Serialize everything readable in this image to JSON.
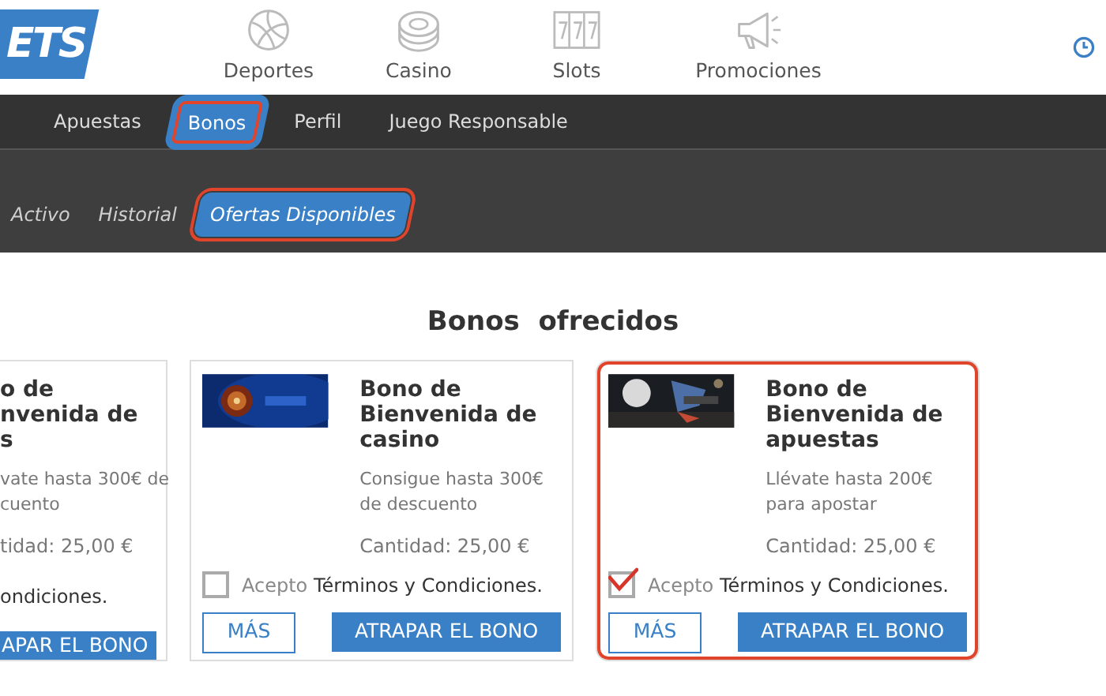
{
  "logo": {
    "text": "ETS"
  },
  "main_nav": [
    {
      "label": "Deportes"
    },
    {
      "label": "Casino"
    },
    {
      "label": "Slots"
    },
    {
      "label": "Promociones"
    }
  ],
  "tabs": [
    {
      "label": "Apuestas",
      "selected": false,
      "highlighted": false
    },
    {
      "label": "Bonos",
      "selected": true,
      "highlighted": true
    },
    {
      "label": "Perfil",
      "selected": false,
      "highlighted": false
    },
    {
      "label": "Juego Responsable",
      "selected": false,
      "highlighted": false
    }
  ],
  "subtabs": [
    {
      "label": "Activo",
      "selected": false,
      "highlighted": false
    },
    {
      "label": "Historial",
      "selected": false,
      "highlighted": false
    },
    {
      "label": "Ofertas Disponibles",
      "selected": true,
      "highlighted": true
    }
  ],
  "heading": "Bonos  ofrecidos",
  "cards": [
    {
      "kind": "cut",
      "title_lines": [
        "o de",
        "nvenida de",
        "s"
      ],
      "description_lines": [
        "vate hasta 300€ de",
        "cuento"
      ],
      "amount": "tidad: 25,00 €",
      "terms": "ondiciones.",
      "claim_button": "APAR EL BONO",
      "highlighted": false
    },
    {
      "kind": "full",
      "title": "Bono de Bienvenida de casino",
      "description": "Consigue hasta 300€ de descuento",
      "amount": "Cantidad: 25,00 €",
      "terms_prefix": "Acepto",
      "terms_link": "Términos y Condiciones.",
      "checked": false,
      "more_button": "MÁS",
      "claim_button": "ATRAPAR EL BONO",
      "highlighted": false
    },
    {
      "kind": "full",
      "title": "Bono de Bienvenida de apuestas",
      "description": "Llévate hasta 200€ para apostar",
      "amount": "Cantidad: 25,00 €",
      "terms_prefix": "Acepto",
      "terms_link": "Términos y Condiciones.",
      "checked": true,
      "more_button": "MÁS",
      "claim_button": "ATRAPAR EL BONO",
      "highlighted": true
    }
  ]
}
